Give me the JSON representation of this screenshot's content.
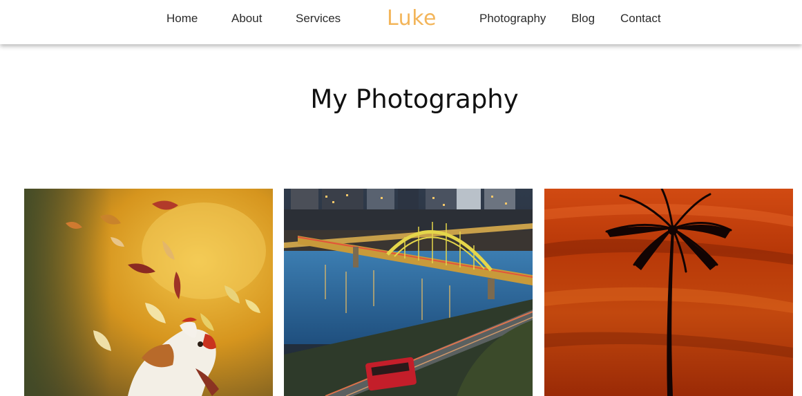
{
  "nav": {
    "home": "Home",
    "about": "About",
    "services": "Services",
    "brand": "Luke",
    "photography": "Photography",
    "blog": "Blog",
    "contact": "Contact"
  },
  "main": {
    "title": "My Photography"
  },
  "gallery": [
    {
      "subject": "autumn-dog-leaves-photo"
    },
    {
      "subject": "city-bridge-river-photo"
    },
    {
      "subject": "palm-tree-sunset-photo"
    }
  ],
  "colors": {
    "brand": "#f3b55a",
    "nav_text": "#2b2b2b",
    "title_text": "#111111"
  }
}
